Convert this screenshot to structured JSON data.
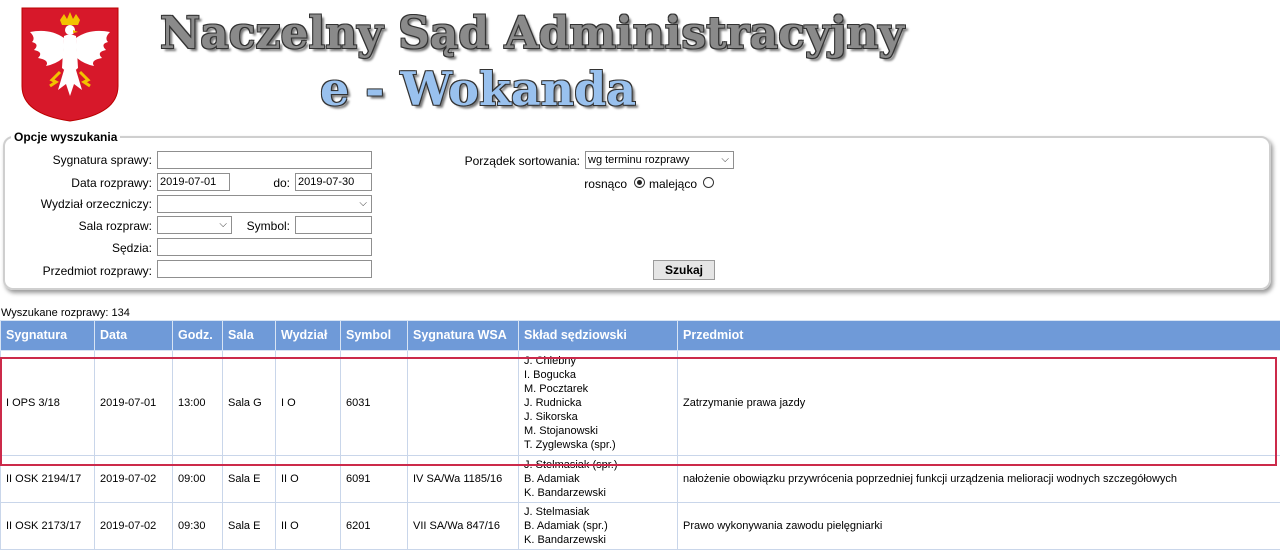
{
  "header": {
    "title": "Naczelny Sąd Administracyjny",
    "subtitle": "e - Wokanda"
  },
  "search": {
    "legend": "Opcje wyszukania",
    "sygnatura_label": "Sygnatura sprawy:",
    "sygnatura_value": "",
    "data_label": "Data rozprawy:",
    "date_from": "2019-07-01",
    "do_label": "do:",
    "date_to": "2019-07-30",
    "wydzial_label": "Wydział orzeczniczy:",
    "wydzial_value": "",
    "sala_label": "Sala rozpraw:",
    "sala_value": "",
    "symbol_label": "Symbol:",
    "symbol_value": "",
    "sedzia_label": "Sędzia:",
    "sedzia_value": "",
    "przedmiot_label": "Przedmiot rozprawy:",
    "przedmiot_value": "",
    "sort_label": "Porządek sortowania:",
    "sort_value": "wg terminu rozprawy",
    "asc_label": "rosnąco",
    "desc_label": "malejąco",
    "asc_selected": true,
    "search_button": "Szukaj"
  },
  "results": {
    "count_text": "Wyszukane rozprawy: 134",
    "headers": [
      "Sygnatura",
      "Data",
      "Godz.",
      "Sala",
      "Wydział",
      "Symbol",
      "Sygnatura WSA",
      "Skład sędziowski",
      "Przedmiot"
    ],
    "rows": [
      {
        "sygnatura": "I OPS 3/18",
        "data": "2019-07-01",
        "godz": "13:00",
        "sala": "Sala G",
        "wydzial": "I O",
        "symbol": "6031",
        "wsa": "",
        "judges": [
          "J. Chlebny",
          "I. Bogucka",
          "M. Pocztarek",
          "J. Rudnicka",
          "J. Sikorska",
          "M. Stojanowski",
          "T. Zyglewska (spr.)"
        ],
        "przedmiot": "Zatrzymanie prawa jazdy"
      },
      {
        "sygnatura": "II OSK 2194/17",
        "data": "2019-07-02",
        "godz": "09:00",
        "sala": "Sala E",
        "wydzial": "II O",
        "symbol": "6091",
        "wsa": "IV SA/Wa 1185/16",
        "judges": [
          "J. Stelmasiak (spr.)",
          "B. Adamiak",
          "K. Bandarzewski"
        ],
        "przedmiot": "nałożenie obowiązku przywrócenia poprzedniej funkcji urządzenia melioracji wodnych szczegółowych"
      },
      {
        "sygnatura": "II OSK 2173/17",
        "data": "2019-07-02",
        "godz": "09:30",
        "sala": "Sala E",
        "wydzial": "II O",
        "symbol": "6201",
        "wsa": "VII SA/Wa 847/16",
        "judges": [
          "J. Stelmasiak",
          "B. Adamiak (spr.)",
          "K. Bandarzewski"
        ],
        "przedmiot": "Prawo wykonywania zawodu pielęgniarki"
      }
    ]
  },
  "colors": {
    "header_bg": "#6f9ad8",
    "highlight": "#cc2a4a",
    "subtitle": "#99c1ee"
  }
}
